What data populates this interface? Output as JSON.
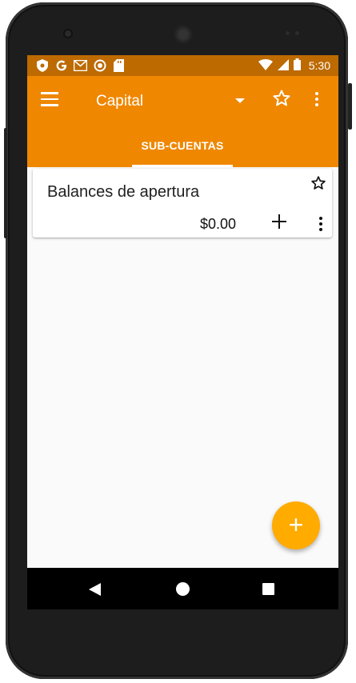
{
  "status_bar": {
    "time": "5:30",
    "left_icons": [
      "shield-icon",
      "google-icon",
      "gmail-icon",
      "circle-icon",
      "sd-card-icon"
    ],
    "right_icons": [
      "wifi-icon",
      "signal-icon",
      "battery-icon"
    ]
  },
  "appbar": {
    "title": "Capital",
    "icons": [
      "menu-icon",
      "dropdown-icon",
      "star-outline-icon",
      "more-vert-icon"
    ]
  },
  "tabs": [
    {
      "label": "SUB-CUENTAS",
      "selected": true
    }
  ],
  "accounts": [
    {
      "name": "Balances de apertura",
      "balance": "$0.00",
      "favorite": false
    }
  ],
  "fab": {
    "label": "+"
  },
  "colors": {
    "status_bar": "#bd6a00",
    "app_bar": "#ef8700",
    "fab": "#ffab00",
    "background": "#fafafa"
  }
}
